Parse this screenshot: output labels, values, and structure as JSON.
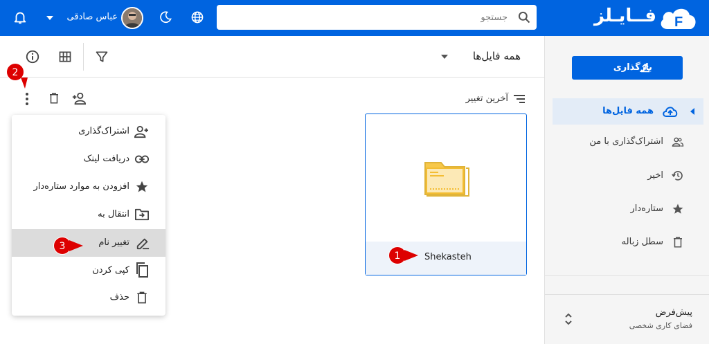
{
  "app": {
    "logo_text": "فــایـلز",
    "brand_color": "#0064e0"
  },
  "topbar": {
    "search_placeholder": "جستجو",
    "user_name": "عباس صادقی",
    "icons": [
      "notification-bell-icon",
      "chevron-down-icon",
      "avatar",
      "dark-mode-moon-icon",
      "language-globe-icon",
      "search-icon"
    ]
  },
  "sidebar": {
    "upload_label": "بارگذاری",
    "items": [
      {
        "label": "همه فایل‌ها",
        "icon": "cloud-upload-icon",
        "active": true
      },
      {
        "label": "اشتراک‌گذاری با من",
        "icon": "people-icon",
        "active": false
      },
      {
        "label": "اخیر",
        "icon": "history-icon",
        "active": false
      },
      {
        "label": "ستاره‌دار",
        "icon": "star-icon",
        "active": false
      },
      {
        "label": "سطل زباله",
        "icon": "trash-icon",
        "active": false
      }
    ],
    "workspace": {
      "name": "پیش‌فرض",
      "subtitle": "فضای کاری شخصی"
    }
  },
  "main": {
    "title": "همه فایل‌ها",
    "sort_label": "آخرین تغییر",
    "folder": {
      "name": "Shekasteh"
    }
  },
  "context_menu": {
    "items": [
      {
        "label": "اشتراک‌گذاری",
        "icon": "person-add-icon"
      },
      {
        "label": "دریافت لینک",
        "icon": "link-icon"
      },
      {
        "label": "افزودن به موارد ستاره‌دار",
        "icon": "star-icon"
      },
      {
        "label": "انتقال به",
        "icon": "folder-move-icon"
      },
      {
        "label": "تغییر نام",
        "icon": "rename-edit-icon",
        "highlighted": true
      },
      {
        "label": "کپی کردن",
        "icon": "copy-icon"
      },
      {
        "label": "حذف",
        "icon": "trash-icon"
      }
    ]
  },
  "annotations": {
    "badge1": "1",
    "badge2": "2",
    "badge3": "3",
    "badge_color": "#dd0000"
  }
}
